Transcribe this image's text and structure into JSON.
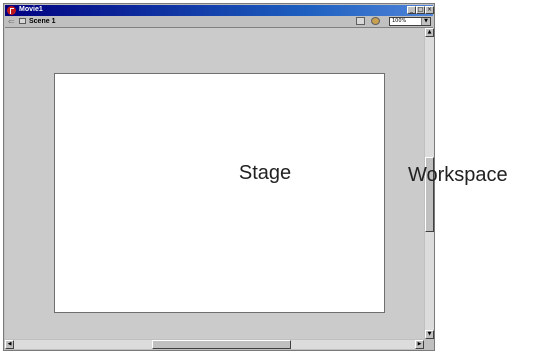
{
  "window": {
    "title": "Movie1",
    "controls": {
      "minimize": "_",
      "maximize": "□",
      "close": "×"
    }
  },
  "toolbar": {
    "back_glyph": "⇐",
    "scene_label": "Scene 1",
    "edit_scene_icon": "edit-scene-icon",
    "edit_symbol_icon": "edit-symbol-icon",
    "zoom_value": "100%",
    "zoom_arrow": "▼"
  },
  "canvas": {
    "stage_label": "Stage",
    "workspace_label": "Workspace"
  },
  "scrollbars": {
    "up": "▲",
    "down": "▼",
    "left": "◀",
    "right": "▶"
  }
}
